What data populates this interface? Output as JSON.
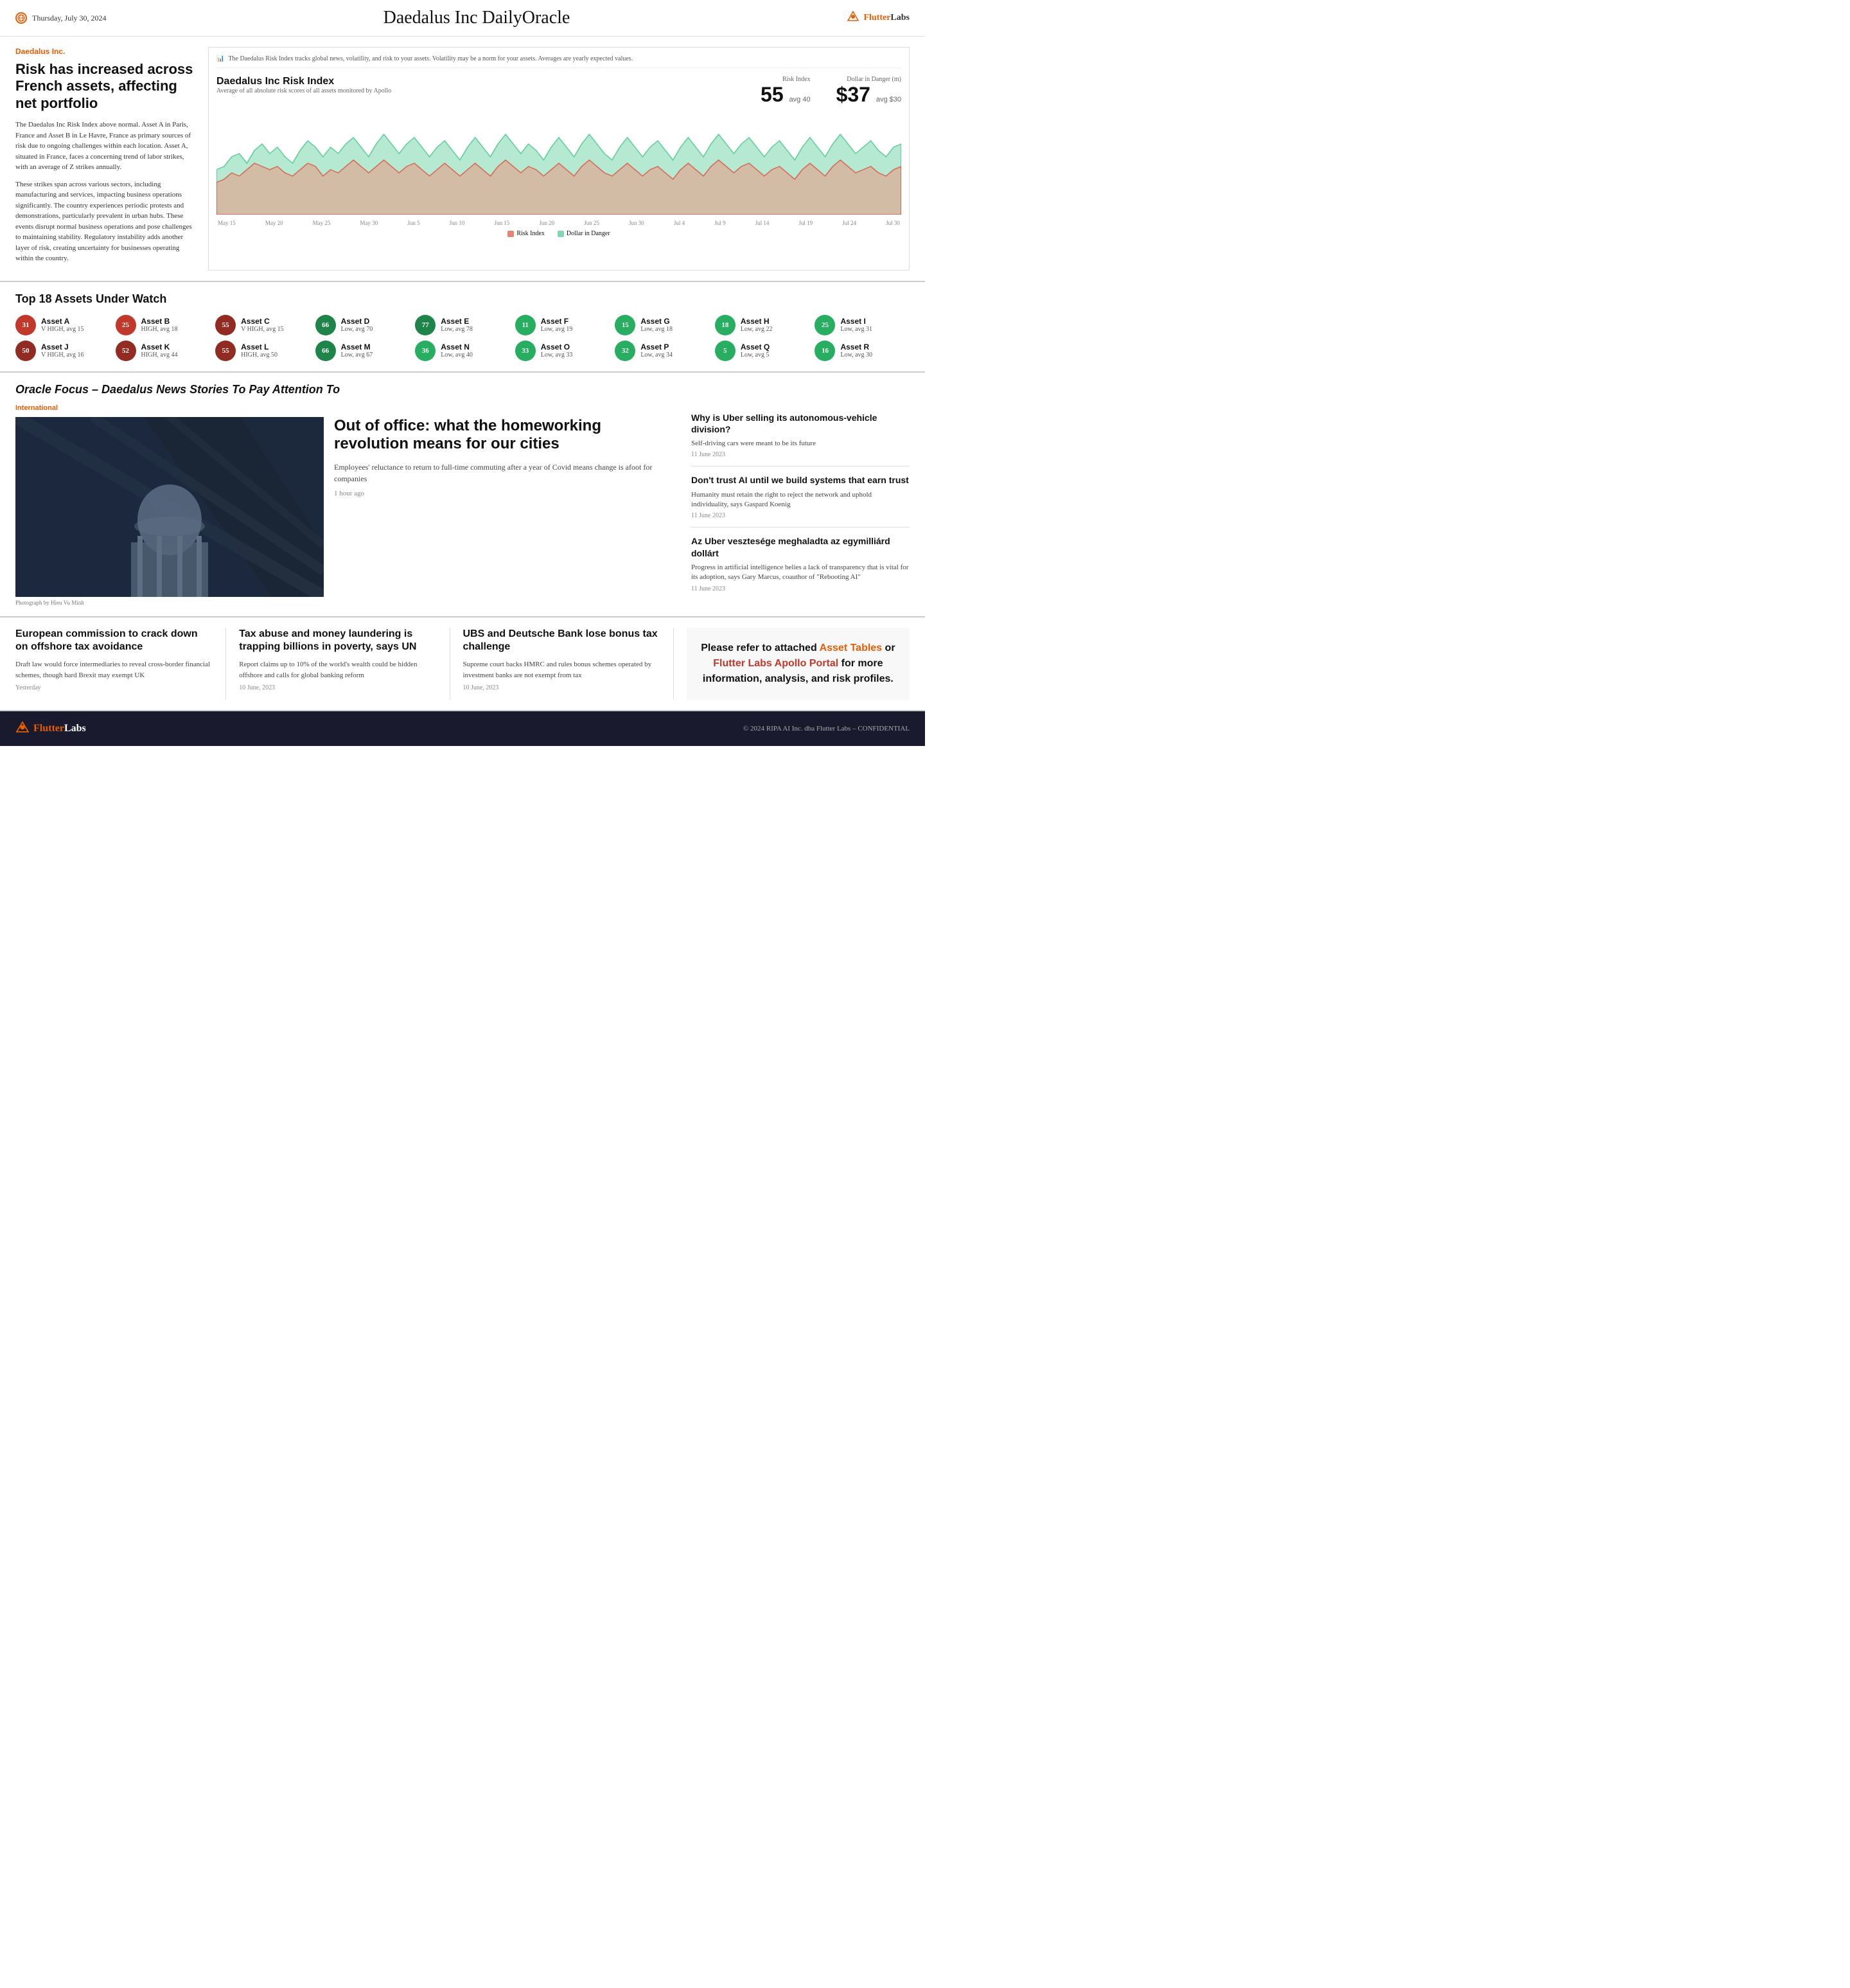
{
  "header": {
    "date": "Thursday, July 30, 2024",
    "title": "Daedalus Inc DailyOracle",
    "logo_text": "FlutterLabs"
  },
  "risk_section": {
    "company_label": "Daedalus Inc.",
    "headline": "Risk has increased across French assets, affecting net portfolio",
    "body_1": "The Daedalus Inc Risk Index above normal. Asset A in Paris, France and Asset B in Le Havre, France as primary sources of risk due to ongoing challenges within each location. Asset A, situated in France, faces a concerning trend of labor strikes, with an average of Z strikes annually.",
    "body_2": "These strikes span across various sectors, including manufacturing and services, impacting business operations significantly. The country experiences periodic protests and demonstrations, particularly prevalent in urban hubs. These events disrupt normal business operations and pose challenges to maintaining stability. Regulatory instability adds another layer of risk, creating uncertainty for businesses operating within the country.",
    "notice": "The Daedalus Risk Index tracks global news, volatility, and risk to your assets. Volatility may be a norm for your assets. Averages are yearly expected values.",
    "risk_index_title": "Daedalus Inc Risk Index",
    "risk_index_subtitle": "Average of all absolute risk scores of all assets monitored by Apollo",
    "risk_index_label": "Risk Index",
    "risk_index_value": "55",
    "risk_index_avg": "avg 40",
    "dollar_label": "Dollar in Danger (m)",
    "dollar_value": "$37",
    "dollar_avg": "avg $30",
    "legend_risk": "Risk Index",
    "legend_dollar": "Dollar in Danger",
    "chart_labels": [
      "May 15",
      "May 20",
      "May 25",
      "May 30",
      "Jun 5",
      "Jun 10",
      "Jun 15",
      "Jun 20",
      "Jun 25",
      "Jun 30",
      "Jul 4",
      "Jul 9",
      "Jul 14",
      "Jul 19",
      "Jul 24",
      "Jul 30"
    ]
  },
  "assets": {
    "title": "Top 18 Assets Under Watch",
    "items": [
      {
        "value": "31",
        "name": "Asset A",
        "detail": "V HIGH, avg 15",
        "color": "badge-red"
      },
      {
        "value": "25",
        "name": "Asset B",
        "detail": "HIGH, avg 18",
        "color": "badge-red"
      },
      {
        "value": "55",
        "name": "Asset C",
        "detail": "V HIGH, avg 15",
        "color": "badge-dark-red"
      },
      {
        "value": "66",
        "name": "Asset D",
        "detail": "Low, avg 70",
        "color": "badge-dark-green"
      },
      {
        "value": "77",
        "name": "Asset E",
        "detail": "Low, avg 78",
        "color": "badge-dark-green"
      },
      {
        "value": "11",
        "name": "Asset F",
        "detail": "Low, avg 19",
        "color": "badge-green"
      },
      {
        "value": "15",
        "name": "Asset G",
        "detail": "Low, avg 18",
        "color": "badge-green"
      },
      {
        "value": "18",
        "name": "Asset H",
        "detail": "Low, avg 22",
        "color": "badge-green"
      },
      {
        "value": "25",
        "name": "Asset I",
        "detail": "Low, avg 31",
        "color": "badge-green"
      },
      {
        "value": "50",
        "name": "Asset J",
        "detail": "V HIGH, avg 16",
        "color": "badge-dark-red"
      },
      {
        "value": "52",
        "name": "Asset K",
        "detail": "HIGH, avg 44",
        "color": "badge-dark-red"
      },
      {
        "value": "55",
        "name": "Asset L",
        "detail": "HIGH, avg 50",
        "color": "badge-dark-red"
      },
      {
        "value": "66",
        "name": "Asset M",
        "detail": "Low, avg 67",
        "color": "badge-dark-green"
      },
      {
        "value": "36",
        "name": "Asset N",
        "detail": "Low, avg 40",
        "color": "badge-green"
      },
      {
        "value": "33",
        "name": "Asset O",
        "detail": "Low, avg 33",
        "color": "badge-green"
      },
      {
        "value": "32",
        "name": "Asset P",
        "detail": "Low, avg 34",
        "color": "badge-green"
      },
      {
        "value": "5",
        "name": "Asset Q",
        "detail": "Low, avg 5",
        "color": "badge-green"
      },
      {
        "value": "16",
        "name": "Asset R",
        "detail": "Low, avg 30",
        "color": "badge-green"
      }
    ]
  },
  "oracle": {
    "title": "Oracle Focus – Daedalus News Stories To Pay Attention To",
    "category": "International",
    "featured": {
      "headline": "Out of office: what the homeworking revolution means for our cities",
      "summary": "Employees' reluctance to return to full-time commuting after a year of Covid means change is afoot for companies",
      "time": "1 hour ago",
      "caption": "Photograph by Hieu Vu Minh"
    },
    "sidebar_articles": [
      {
        "headline": "Why is Uber selling its autonomous-vehicle division?",
        "summary": "Self-driving cars were meant to be its future",
        "date": "11 June 2023"
      },
      {
        "headline": "Don't trust AI until we build systems that earn trust",
        "summary": "Humanity must retain the right to reject the network and uphold individuality, says Gaspard Koenig",
        "date": "11 June 2023"
      },
      {
        "headline": "Az Uber vesztesége meghaladta az egymilliárd dollárt",
        "summary": "Progress in artificial intelligence belies a lack of transparency that is vital for its adoption, says Gary Marcus, coauthor of \"Rebooting AI\"",
        "date": "11 June 2023"
      }
    ]
  },
  "bottom_news": [
    {
      "headline": "European commission to crack down on offshore tax avoidance",
      "summary": "Draft law would force intermediaries to reveal cross-border financial schemes, though hard Brexit may exempt UK",
      "date": "Yesterday"
    },
    {
      "headline": "Tax abuse and money laundering is trapping billions in poverty, says UN",
      "summary": "Report claims up to 10% of the world's wealth could be hidden offshore and calls for global banking reform",
      "date": "10 June, 2023"
    },
    {
      "headline": "UBS and Deutsche Bank lose bonus tax challenge",
      "summary": "Supreme court backs HMRC and rules bonus schemes operated by investment banks are not exempt from tax",
      "date": "10 June, 2023"
    }
  ],
  "cta": {
    "text": "Please refer to attached ",
    "link1": "Asset Tables",
    "middle": " or ",
    "link2": "Flutter Labs Apollo Portal",
    "end": " for more information, analysis, and risk profiles."
  },
  "footer": {
    "logo": "FlutterLabs",
    "copyright": "© 2024 RIPA AI Inc. dba Flutter Labs – CONFIDENTIAL"
  }
}
